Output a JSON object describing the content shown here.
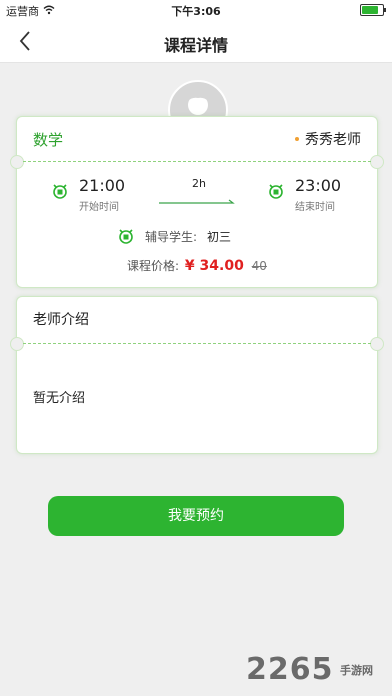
{
  "status_bar": {
    "carrier": "运营商",
    "time": "下午3:06"
  },
  "nav": {
    "title": "课程详情"
  },
  "course": {
    "subject": "数学",
    "teacher": "秀秀老师",
    "start_time": "21:00",
    "start_label": "开始时间",
    "duration": "2h",
    "end_time": "23:00",
    "end_label": "结束时间",
    "student_label": "辅导学生:",
    "student_grade": "初三",
    "price_label": "课程价格:",
    "price_current": "¥ 34.00",
    "price_original": "40"
  },
  "teacher_intro": {
    "title": "老师介绍",
    "text": "暂无介绍"
  },
  "cta": {
    "label": "我要预约"
  },
  "watermark": {
    "text": "2265",
    "suffix": "手游网"
  },
  "colors": {
    "accent": "#2db431",
    "price": "#e02020",
    "dot": "#f0a033"
  }
}
